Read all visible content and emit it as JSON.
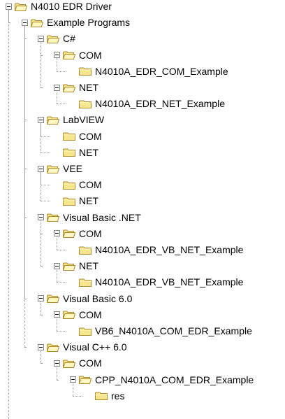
{
  "tree": [
    {
      "label": "N4010 EDR Driver",
      "depth": 0,
      "expanded": true,
      "icon": "folder-open-icon"
    },
    {
      "label": "Example Programs",
      "depth": 1,
      "expanded": true,
      "icon": "folder-open-icon"
    },
    {
      "label": "C#",
      "depth": 2,
      "expanded": true,
      "icon": "folder-open-icon"
    },
    {
      "label": "COM",
      "depth": 3,
      "expanded": true,
      "icon": "folder-open-icon"
    },
    {
      "label": "N4010A_EDR_COM_Example",
      "depth": 4,
      "expanded": false,
      "leaf": true,
      "icon": "folder-icon"
    },
    {
      "label": "NET",
      "depth": 3,
      "expanded": true,
      "icon": "folder-open-icon"
    },
    {
      "label": "N4010A_EDR_NET_Example",
      "depth": 4,
      "expanded": false,
      "leaf": true,
      "icon": "folder-icon"
    },
    {
      "label": "LabVIEW",
      "depth": 2,
      "expanded": true,
      "icon": "folder-open-icon"
    },
    {
      "label": "COM",
      "depth": 3,
      "expanded": false,
      "leaf": true,
      "icon": "folder-icon"
    },
    {
      "label": "NET",
      "depth": 3,
      "expanded": false,
      "leaf": true,
      "icon": "folder-icon"
    },
    {
      "label": "VEE",
      "depth": 2,
      "expanded": true,
      "icon": "folder-open-icon"
    },
    {
      "label": "COM",
      "depth": 3,
      "expanded": false,
      "leaf": true,
      "icon": "folder-icon"
    },
    {
      "label": "NET",
      "depth": 3,
      "expanded": false,
      "leaf": true,
      "icon": "folder-icon"
    },
    {
      "label": "Visual Basic .NET",
      "depth": 2,
      "expanded": true,
      "icon": "folder-open-icon"
    },
    {
      "label": "COM",
      "depth": 3,
      "expanded": true,
      "icon": "folder-open-icon"
    },
    {
      "label": "N4010A_EDR_VB_NET_Example",
      "depth": 4,
      "expanded": false,
      "leaf": true,
      "icon": "folder-icon"
    },
    {
      "label": "NET",
      "depth": 3,
      "expanded": true,
      "icon": "folder-open-icon"
    },
    {
      "label": "N4010A_EDR_VB_NET_Example",
      "depth": 4,
      "expanded": false,
      "leaf": true,
      "icon": "folder-icon"
    },
    {
      "label": "Visual Basic 6.0",
      "depth": 2,
      "expanded": true,
      "icon": "folder-open-icon"
    },
    {
      "label": "COM",
      "depth": 3,
      "expanded": true,
      "icon": "folder-open-icon"
    },
    {
      "label": "VB6_N4010A_COM_EDR_Example",
      "depth": 4,
      "expanded": false,
      "leaf": true,
      "icon": "folder-icon"
    },
    {
      "label": "Visual C++ 6.0",
      "depth": 2,
      "expanded": true,
      "icon": "folder-open-icon"
    },
    {
      "label": "COM",
      "depth": 3,
      "expanded": true,
      "icon": "folder-open-icon"
    },
    {
      "label": "CPP_N4010A_COM_EDR_Example",
      "depth": 4,
      "expanded": true,
      "icon": "folder-open-icon"
    },
    {
      "label": "res",
      "depth": 5,
      "expanded": false,
      "leaf": true,
      "icon": "folder-icon"
    }
  ],
  "colors": {
    "folder_fill": "#f5e58c",
    "folder_stroke": "#b08a2e",
    "connector": "#9a9a9a"
  }
}
